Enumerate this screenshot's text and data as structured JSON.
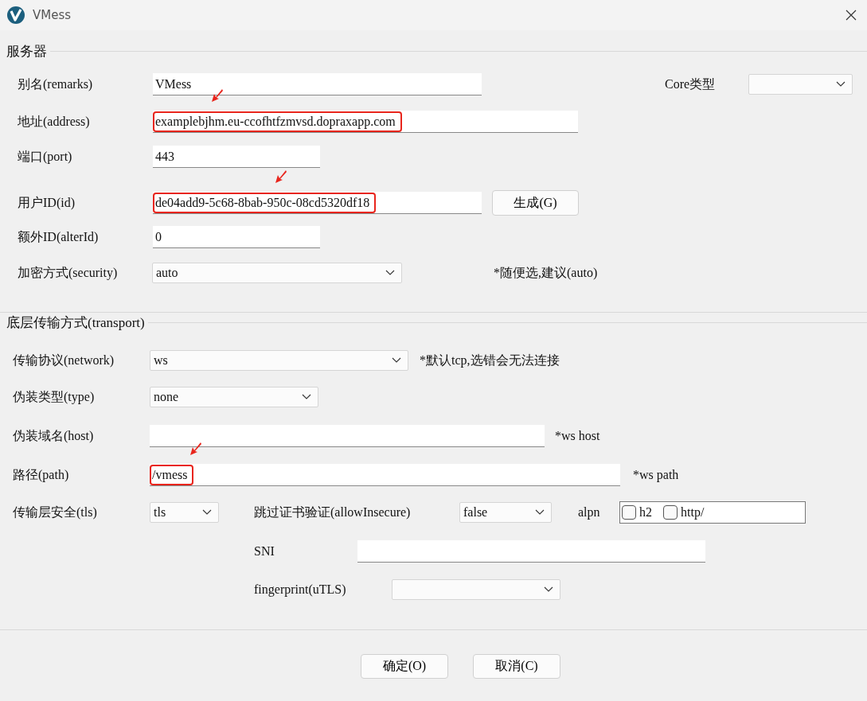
{
  "window": {
    "title": "VMess"
  },
  "groups": [
    {
      "title": "服务器",
      "rows": [
        {
          "items": [
            {
              "kind": "label",
              "text": "别名(remarks)"
            },
            {
              "kind": "text",
              "value": "VMess",
              "annotated": false
            },
            {
              "kind": "label",
              "text": "Core类型"
            },
            {
              "kind": "select"
            }
          ]
        },
        {
          "items": [
            {
              "kind": "label",
              "text": "地址(address)"
            },
            {
              "kind": "text",
              "value": "examplebjhm.eu-ccofhtfzmvsd.dopraxapp.com",
              "annotated": true
            }
          ]
        },
        {
          "items": [
            {
              "kind": "label",
              "text": "端口(port)"
            },
            {
              "kind": "text",
              "value": "443",
              "annotated": false
            }
          ]
        },
        {
          "items": [
            {
              "kind": "label",
              "text": "用户ID(id)"
            },
            {
              "kind": "text",
              "value": "de04add9-5c68-8bab-950c-08cd5320df18",
              "annotated": true
            },
            {
              "kind": "button",
              "text": "生成(G)"
            }
          ]
        },
        {
          "items": [
            {
              "kind": "label",
              "text": "额外ID(alterId)"
            },
            {
              "kind": "text",
              "value": "0",
              "annotated": false
            }
          ]
        },
        {
          "items": [
            {
              "kind": "label",
              "text": "加密方式(security)"
            },
            {
              "kind": "select",
              "value": "auto"
            },
            {
              "kind": "note",
              "text": "*随便选,建议(auto)"
            }
          ]
        }
      ]
    },
    {
      "title": "底层传输方式(transport)",
      "rows": [
        {
          "items": [
            {
              "kind": "label",
              "text": "传输协议(network)"
            },
            {
              "kind": "select",
              "value": "ws"
            },
            {
              "kind": "note",
              "text": "*默认tcp,选错会无法连接"
            }
          ]
        },
        {
          "items": [
            {
              "kind": "label",
              "text": "伪装类型(type)"
            },
            {
              "kind": "select",
              "value": "none"
            }
          ]
        },
        {
          "items": [
            {
              "kind": "label",
              "text": "伪装域名(host)"
            },
            {
              "kind": "text",
              "annotated": false
            },
            {
              "kind": "note",
              "text": "*ws host"
            }
          ]
        },
        {
          "items": [
            {
              "kind": "label",
              "text": "路径(path)"
            },
            {
              "kind": "text",
              "value": "/vmess",
              "annotated": true
            },
            {
              "kind": "note",
              "text": "*ws path"
            }
          ]
        },
        {
          "items": [
            {
              "kind": "label",
              "text": "传输层安全(tls)"
            },
            {
              "kind": "select",
              "value": "tls"
            },
            {
              "kind": "label",
              "text": "跳过证书验证(allowInsecure)"
            },
            {
              "kind": "select",
              "value": "false"
            },
            {
              "kind": "label",
              "text": "alpn"
            },
            {
              "kind": "checks",
              "options": [
                {
                  "label": "h2",
                  "checked": false
                },
                {
                  "label": "http/",
                  "checked": false
                }
              ]
            }
          ]
        },
        {
          "items": [
            {
              "kind": "label",
              "text": "SNI"
            },
            {
              "kind": "text",
              "annotated": false
            }
          ]
        },
        {
          "items": [
            {
              "kind": "label",
              "text": "fingerprint(uTLS)"
            },
            {
              "kind": "select"
            }
          ]
        }
      ]
    }
  ],
  "buttons": [
    "确定(O)",
    "取消(C)"
  ]
}
